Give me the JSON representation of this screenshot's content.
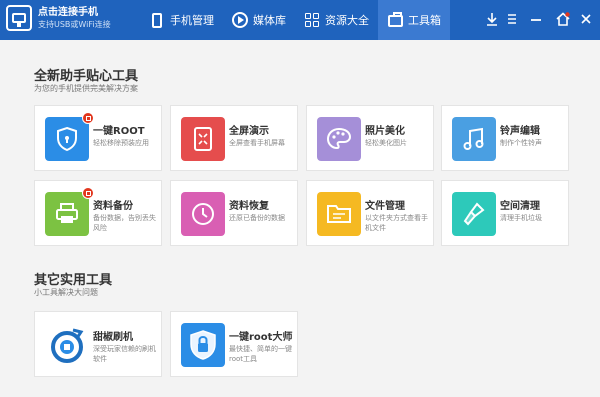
{
  "app": {
    "title": "点击连接手机",
    "subtitle": "支持USB或WiFi连接"
  },
  "nav": [
    {
      "label": "手机管理",
      "icon": "phone-icon"
    },
    {
      "label": "媒体库",
      "icon": "play-icon"
    },
    {
      "label": "资源大全",
      "icon": "grid-icon"
    },
    {
      "label": "工具箱",
      "icon": "toolbox-icon",
      "active": true
    }
  ],
  "window_controls": [
    "download-icon",
    "menu-icon",
    "minimize-icon",
    "home-icon",
    "close-icon"
  ],
  "section1": {
    "title": "全新助手贴心工具",
    "subtitle": "为您的手机提供完美解决方案"
  },
  "tools": [
    {
      "name": "一键ROOT",
      "desc": "轻松移除预装应用",
      "color": "#2b8de6",
      "icon": "shield-icon"
    },
    {
      "name": "全屏演示",
      "desc": "全屏查看手机屏幕",
      "color": "#e54d4d",
      "icon": "fullscreen-icon"
    },
    {
      "name": "照片美化",
      "desc": "轻松美化图片",
      "color": "#a58fd8",
      "icon": "palette-icon"
    },
    {
      "name": "铃声编辑",
      "desc": "制作个性铃声",
      "color": "#4a9fe2",
      "icon": "music-note-icon"
    },
    {
      "name": "资料备份",
      "desc": "备份数据，告别丢失风险",
      "color": "#7cc242",
      "icon": "printer-icon"
    },
    {
      "name": "资料恢复",
      "desc": "还原已备份的数据",
      "color": "#d95fb3",
      "icon": "clock-icon"
    },
    {
      "name": "文件管理",
      "desc": "以文件夹方式查看手机文件",
      "color": "#f5b922",
      "icon": "folder-icon"
    },
    {
      "name": "空间清理",
      "desc": "清理手机垃圾",
      "color": "#2dc9ba",
      "icon": "broom-icon"
    }
  ],
  "section2": {
    "title": "其它实用工具",
    "subtitle": "小工具解决大问题"
  },
  "other_tools": [
    {
      "name": "甜椒刷机",
      "desc": "深受玩家信赖的刷机软件",
      "icon": "tianjiao-logo-icon"
    },
    {
      "name": "一键root大师",
      "desc": "最快捷、简单的一键root工具",
      "icon": "root-master-shield-icon"
    }
  ]
}
